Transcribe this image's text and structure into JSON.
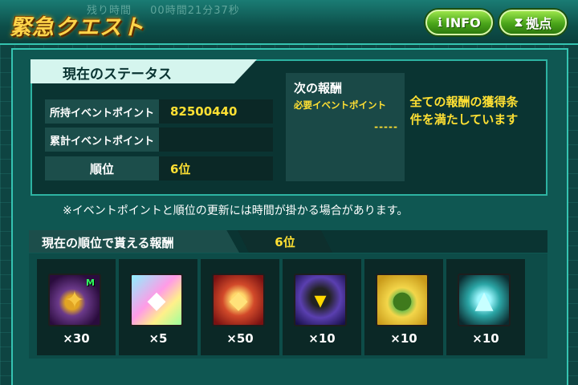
{
  "header": {
    "title": "緊急クエスト",
    "timer_label": "残り時間",
    "timer_value": "00時間21分37秒",
    "info_button": "INFO",
    "base_button": "拠点"
  },
  "status": {
    "section_title": "現在のステータス",
    "rows": [
      {
        "label": "所持イベントポイント",
        "value": "82500440"
      },
      {
        "label": "累計イベントポイント",
        "value": ""
      },
      {
        "label": "順位",
        "value": "6位"
      }
    ],
    "next_reward": {
      "title": "次の報酬",
      "required_label": "必要イベントポイント",
      "required_value": "-----"
    },
    "completion_message": "全ての報酬の獲得条件を満たしています"
  },
  "note": "※イベントポイントと順位の更新には時間が掛かる場合があります。",
  "rank_rewards": {
    "title": "現在の順位で貰える報酬",
    "rank": "6位",
    "items": [
      {
        "name": "unit-m-icon",
        "badge": "M",
        "qty": "×30"
      },
      {
        "name": "ticket-rainbow-icon",
        "qty": "×5"
      },
      {
        "name": "ticket-red-icon",
        "qty": "×50"
      },
      {
        "name": "dark-mobile-suit-icon",
        "qty": "×10"
      },
      {
        "name": "haro-icon",
        "qty": "×10"
      },
      {
        "name": "blue-mobile-suit-icon",
        "qty": "×10"
      }
    ]
  },
  "colors": {
    "accent": "#35c4b2",
    "highlight": "#ffe033",
    "button_green": "#4aa51a"
  }
}
